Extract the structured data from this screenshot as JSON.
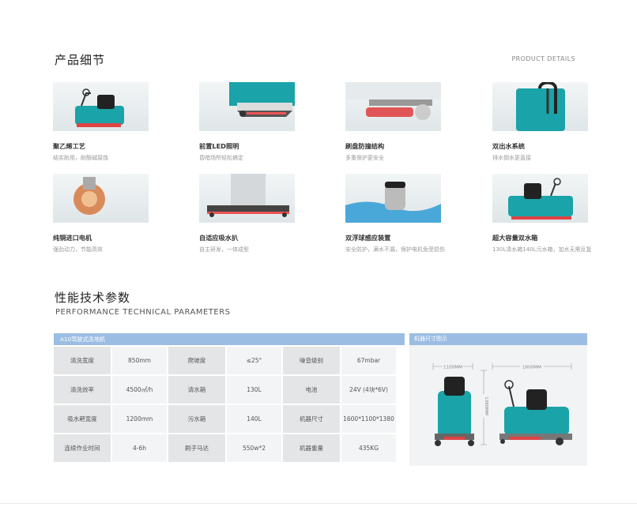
{
  "section1": {
    "title": "产品细节",
    "subtitle_en": "PRODUCT DETAILS"
  },
  "features": [
    {
      "title": "聚乙烯工艺",
      "desc": "结实耐用，耐酸碱腐蚀"
    },
    {
      "title": "前置LED照明",
      "desc": "昏暗场所轻松搞定"
    },
    {
      "title": "刷盘防撞结构",
      "desc": "多重保护更安全"
    },
    {
      "title": "双出水系统",
      "desc": "排水倒水更直接"
    },
    {
      "title": "纯铜进口电机",
      "desc": "强劲动力，节能高效"
    },
    {
      "title": "自适应吸水扒",
      "desc": "自主研发，一体成型"
    },
    {
      "title": "双浮球感应装置",
      "desc": "安全防护，满水不漏，保护电机免受损伤"
    },
    {
      "title": "超大容量双水箱",
      "desc": "130L清水箱140L污水箱，加水无需反复"
    }
  ],
  "section2": {
    "title": "性能技术参数",
    "subtitle_en": "PERFORMANCE TECHNICAL PARAMETERS"
  },
  "specs": {
    "header": "A10驾驶式洗地机",
    "rows": [
      [
        "清洗宽度",
        "850mm",
        "爬坡度",
        "≤25°",
        "噪音级别",
        "67mbar"
      ],
      [
        "清洗效率",
        "4500㎡/h",
        "清水箱",
        "130L",
        "电池",
        "24V (4块*6V)"
      ],
      [
        "吸水耙宽度",
        "1200mm",
        "污水箱",
        "140L",
        "机器尺寸",
        "1600*1100*1380"
      ],
      [
        "连续作业时间",
        "4-6h",
        "刷子马达",
        "550w*2",
        "机器重量",
        "435KG"
      ]
    ]
  },
  "dimensions": {
    "header": "机器尺寸图示",
    "width_label": "1100MM",
    "length_label": "1600MM",
    "height_label": "1380MM"
  },
  "colors": {
    "accent": "#9bbde3",
    "machine": "#1aa3a8"
  }
}
